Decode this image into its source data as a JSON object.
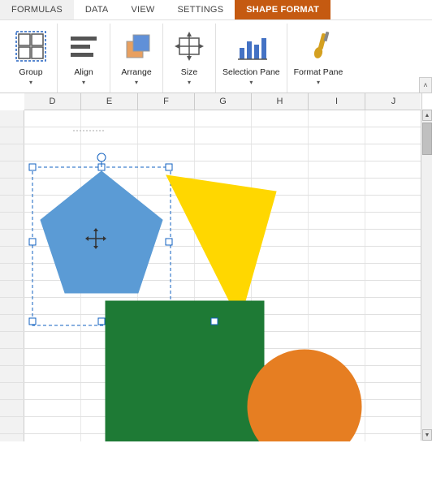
{
  "ribbon": {
    "tabs": [
      {
        "id": "formulas",
        "label": "FORMULAS",
        "active": false
      },
      {
        "id": "data",
        "label": "DATA",
        "active": false
      },
      {
        "id": "view",
        "label": "VIEW",
        "active": false
      },
      {
        "id": "settings",
        "label": "SETTINGS",
        "active": false
      },
      {
        "id": "shape-format",
        "label": "SHAPE FORMAT",
        "active": true
      }
    ],
    "groups": [
      {
        "id": "group",
        "label": "Group",
        "arrow": "▾"
      },
      {
        "id": "align",
        "label": "Align",
        "arrow": "▾"
      },
      {
        "id": "arrange",
        "label": "Arrange",
        "arrow": "▾"
      },
      {
        "id": "size",
        "label": "Size",
        "arrow": "▾"
      },
      {
        "id": "selection-pane",
        "label": "Selection Pane",
        "arrow": "▾"
      },
      {
        "id": "format-pane",
        "label": "Format Pane",
        "arrow": "▾"
      }
    ]
  },
  "spreadsheet": {
    "col_headers": [
      "D",
      "E",
      "F",
      "G",
      "H",
      "I",
      "J"
    ],
    "row_count": 20
  }
}
